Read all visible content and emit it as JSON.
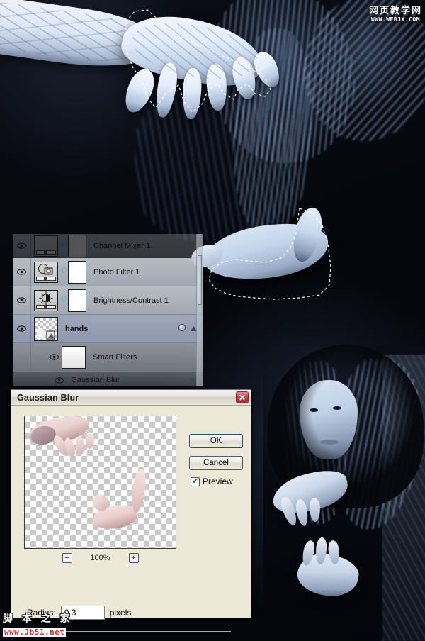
{
  "photo": {
    "description": "Dark gothic photo of a pale woman with blue-lit hair in a black cloak; several luminous pale hands reach across the frame; two hands have active marching-ants selections."
  },
  "layers_panel": {
    "name": "Layers panel",
    "rows": [
      {
        "label": "Channel Mixer 1",
        "kind": "adjustment",
        "visible": true,
        "selected": false,
        "faded": true,
        "indent": 0
      },
      {
        "label": "Photo Filter 1",
        "kind": "adjustment",
        "visible": true,
        "selected": false,
        "faded": false,
        "indent": 0
      },
      {
        "label": "Brightness/Contrast 1",
        "kind": "adjustment",
        "visible": true,
        "selected": false,
        "faded": false,
        "indent": 0
      },
      {
        "label": "hands",
        "kind": "smart-object",
        "visible": true,
        "selected": true,
        "faded": false,
        "indent": 0
      },
      {
        "label": "Smart Filters",
        "kind": "smart-filters",
        "visible": true,
        "selected": false,
        "faded": false,
        "indent": 1
      },
      {
        "label": "Gaussian Blur",
        "kind": "filter",
        "visible": true,
        "selected": false,
        "faded": false,
        "indent": 2
      }
    ]
  },
  "dialog": {
    "title": "Gaussian Blur",
    "close_label": "✕",
    "buttons": {
      "ok": "OK",
      "cancel": "Cancel"
    },
    "preview": {
      "label": "Preview",
      "checked": true,
      "check_glyph": "✔"
    },
    "zoom": {
      "level": "100%",
      "minus": "−",
      "plus": "+"
    },
    "radius": {
      "label": "Radius:",
      "value": "0.3",
      "unit": "pixels"
    }
  },
  "watermarks": {
    "top_right": {
      "cn": "网页教学网",
      "en": "WWW.WEBJX.COM"
    },
    "bottom_left": {
      "cn": "脚 本 之 家",
      "en": "www.Jb51.net"
    }
  },
  "colors": {
    "dialog_face": "#ece9d8",
    "title_bar": "#e6e3dc",
    "close_red": "#c2454c",
    "button_border": "#4a5a78",
    "check_green": "#1f8a23",
    "selection_white": "#ffffff",
    "photo_blue": "#9ab4dd"
  }
}
